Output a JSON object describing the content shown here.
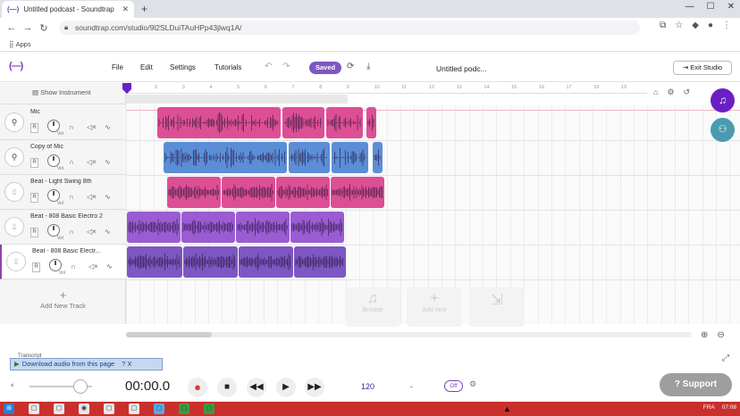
{
  "browser": {
    "tab_title": "Untitled podcast - Soundtrap",
    "tab_favicon": "(—)",
    "url": "soundtrap.com/studio/9l2SLDuiTAuHPp43jlwq1A/",
    "bookmarks_label": "Apps"
  },
  "app": {
    "logo": "(—)",
    "menu": [
      "File",
      "Edit",
      "Settings",
      "Tutorials"
    ],
    "saved_label": "Saved",
    "doc_title": "Untitled podc...",
    "exit_label": "Exit Studio"
  },
  "panel": {
    "show_instrument": "Show Instrument",
    "add_track": "Add New Track",
    "vol_label": "Vol",
    "r_label": "R"
  },
  "tracks": [
    {
      "name": "Mic",
      "icon": "mic-icon",
      "selected": false
    },
    {
      "name": "Copy of Mic",
      "icon": "mic-icon",
      "selected": false
    },
    {
      "name": "Beat - Light Swing 8th",
      "icon": "beat-icon",
      "selected": false
    },
    {
      "name": "Beat - 808 Basic Electro 2",
      "icon": "beat-icon",
      "selected": false
    },
    {
      "name": "Beat - 808 Basic Electr...",
      "icon": "beat-icon",
      "selected": true
    }
  ],
  "ruler_ticks": [
    "2",
    "3",
    "4",
    "5",
    "6",
    "7",
    "8",
    "9",
    "10",
    "11",
    "12",
    "13",
    "14",
    "15",
    "16",
    "17",
    "18",
    "19"
  ],
  "tiles": [
    "Browse",
    "Add new",
    ""
  ],
  "transport": {
    "time": "00:00.0",
    "tempo": "120",
    "key": "-",
    "off_label": "Off",
    "support_label": "Support"
  },
  "extras": {
    "transcript": "Transcript",
    "download_label": "Download audio from this page",
    "download_extra": "?  X"
  },
  "taskbar": {
    "lang": "FRA",
    "clock": "07:08"
  },
  "colors": {
    "pink": "#dd4f95",
    "blue": "#5b8ed6",
    "purple": "#9b5cd3",
    "violet": "#7e57c2"
  }
}
